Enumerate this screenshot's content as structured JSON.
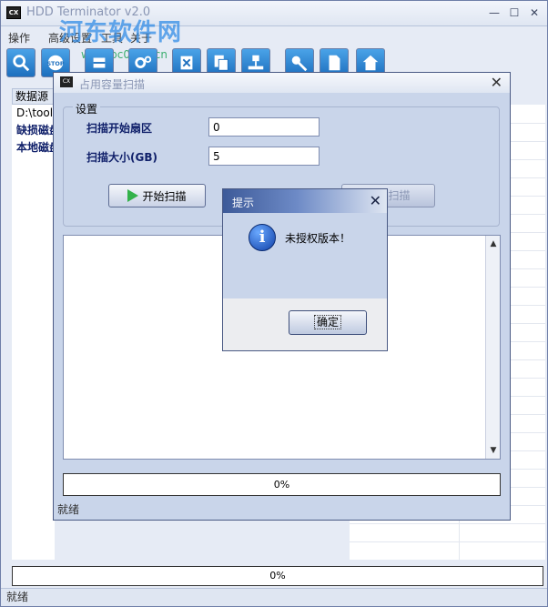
{
  "main_window": {
    "title": "HDD Terminator v2.0",
    "watermark": "河东软件网",
    "watermark_url": "www.pc0359.cn",
    "menu": [
      "操作",
      "高级设置",
      "工具",
      "关于"
    ],
    "toolbar": [
      "search-icon",
      "stop-icon",
      "erase-icon",
      "settings-icon",
      "delete-icon",
      "copy-icon",
      "network-icon",
      "key-icon",
      "document-icon",
      "home-icon"
    ],
    "data_source_header": "数据源",
    "data_source_items": [
      "D:\\tools",
      "缺损磁盘",
      "本地磁盘"
    ],
    "progress": "0%",
    "status": "就绪"
  },
  "scan_window": {
    "title": "占用容量扫描",
    "settings_legend": "设置",
    "start_sector_label": "扫描开始扇区",
    "start_sector_value": "0",
    "scan_size_label": "扫描大小(GB)",
    "scan_size_value": "5",
    "start_button": "开始扫描",
    "stop_button": "停止扫描",
    "progress": "0%",
    "status": "就绪"
  },
  "alert": {
    "title": "提示",
    "message": "未授权版本！",
    "ok_button": "确定"
  }
}
